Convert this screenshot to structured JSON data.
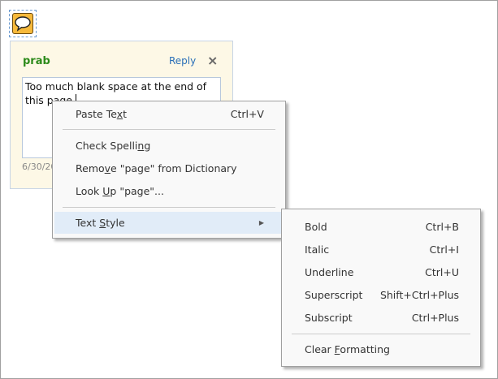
{
  "comment": {
    "author": "prab",
    "reply_label": "Reply",
    "close_icon": "×",
    "text": "Too much blank space at the end of this page.",
    "date": "6/30/20"
  },
  "context_menu": {
    "paste": {
      "pre": "Paste Te",
      "key": "x",
      "post": "t",
      "shortcut": "Ctrl+V"
    },
    "check_spelling": {
      "pre": "Check Spelli",
      "key": "n",
      "post": "g"
    },
    "remove": {
      "pre": "Remo",
      "key": "v",
      "post": "e \"page\" from Dictionary"
    },
    "look_up": {
      "pre": "Look ",
      "key": "U",
      "post": "p \"page\"..."
    },
    "text_style": {
      "pre": "Text ",
      "key": "S",
      "post": "tyle"
    }
  },
  "submenu": {
    "items": [
      {
        "label": "Bold",
        "shortcut": "Ctrl+B"
      },
      {
        "label": "Italic",
        "shortcut": "Ctrl+I"
      },
      {
        "label": "Underline",
        "shortcut": "Ctrl+U"
      },
      {
        "label": "Superscript",
        "shortcut": "Shift+Ctrl+Plus"
      },
      {
        "label": "Subscript",
        "shortcut": "Ctrl+Plus"
      }
    ],
    "clear": {
      "pre": "Clear ",
      "key": "F",
      "post": "ormatting"
    }
  }
}
